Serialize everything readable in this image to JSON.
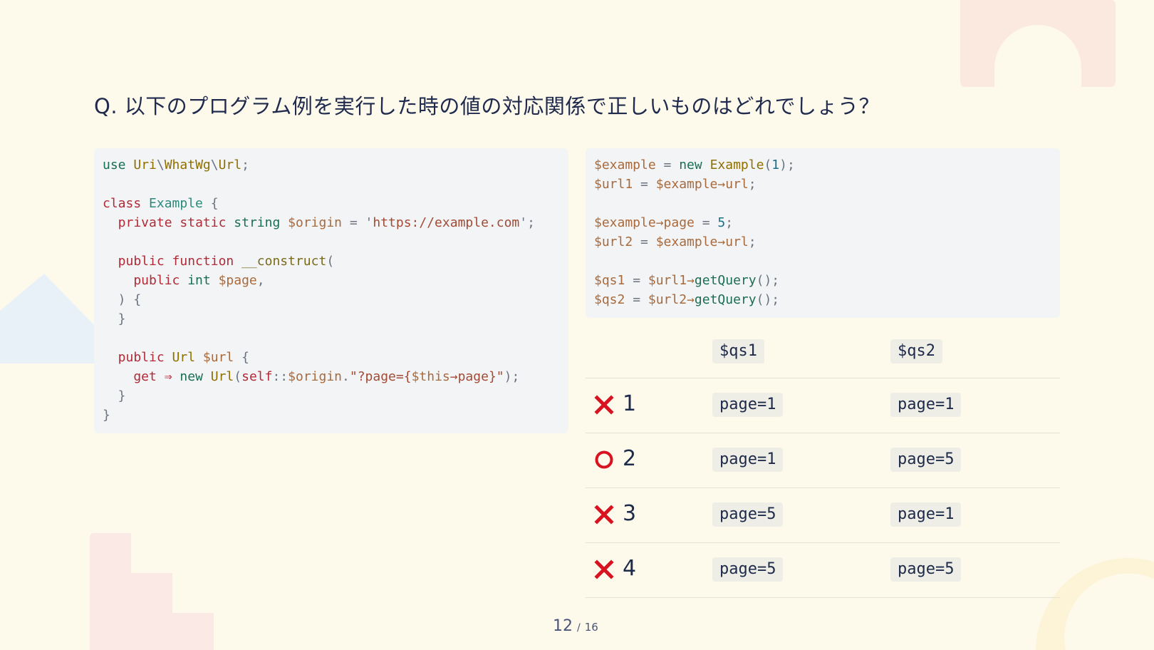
{
  "question": "Q. 以下のプログラム例を実行した時の値の対応関係で正しいものはどれでしょう？",
  "code_left": {
    "lines": [
      [
        [
          "use",
          "kw2"
        ],
        [
          " ",
          "p"
        ],
        [
          "Uri",
          "ns"
        ],
        [
          "\\",
          "p"
        ],
        [
          "WhatWg",
          "ns"
        ],
        [
          "\\",
          "p"
        ],
        [
          "Url",
          "ns"
        ],
        [
          ";",
          "p"
        ]
      ],
      [],
      [
        [
          "class",
          "kw"
        ],
        [
          " ",
          "p"
        ],
        [
          "Example",
          "cls"
        ],
        [
          " {",
          "p"
        ]
      ],
      [
        [
          "  private",
          "kw"
        ],
        [
          " ",
          "p"
        ],
        [
          "static",
          "kw"
        ],
        [
          " ",
          "p"
        ],
        [
          "string",
          "kw2"
        ],
        [
          " ",
          "p"
        ],
        [
          "$origin",
          "var"
        ],
        [
          " = ",
          "p"
        ],
        [
          "'",
          "p"
        ],
        [
          "https://example.com",
          "str"
        ],
        [
          "';",
          "p"
        ]
      ],
      [],
      [
        [
          "  public",
          "kw"
        ],
        [
          " ",
          "p"
        ],
        [
          "function",
          "kw"
        ],
        [
          " ",
          "p"
        ],
        [
          "__construct",
          "fn"
        ],
        [
          "(",
          "p"
        ]
      ],
      [
        [
          "    public",
          "kw"
        ],
        [
          " ",
          "p"
        ],
        [
          "int",
          "kw2"
        ],
        [
          " ",
          "p"
        ],
        [
          "$page",
          "var"
        ],
        [
          ",",
          "p"
        ]
      ],
      [
        [
          "  ) {",
          "p"
        ]
      ],
      [
        [
          "  }",
          "p"
        ]
      ],
      [],
      [
        [
          "  public",
          "kw"
        ],
        [
          " ",
          "p"
        ],
        [
          "Url",
          "ns"
        ],
        [
          " ",
          "p"
        ],
        [
          "$url",
          "var"
        ],
        [
          " {",
          "p"
        ]
      ],
      [
        [
          "    get",
          "kw"
        ],
        [
          " ",
          "p"
        ],
        [
          "⇒",
          "kw"
        ],
        [
          " ",
          "p"
        ],
        [
          "new",
          "kw2"
        ],
        [
          " ",
          "p"
        ],
        [
          "Url",
          "ns"
        ],
        [
          "(",
          "p"
        ],
        [
          "self",
          "kw"
        ],
        [
          "::",
          "p"
        ],
        [
          "$origin",
          "var"
        ],
        [
          ".",
          "p"
        ],
        [
          "\"?page={",
          "str"
        ],
        [
          "$this",
          "var"
        ],
        [
          "→",
          "str"
        ],
        [
          "page",
          "str"
        ],
        [
          "}\"",
          "str"
        ],
        [
          ");",
          "p"
        ]
      ],
      [
        [
          "  }",
          "p"
        ]
      ],
      [
        [
          "}",
          "p"
        ]
      ]
    ]
  },
  "code_right": {
    "lines": [
      [
        [
          "$example",
          "var"
        ],
        [
          " = ",
          "p"
        ],
        [
          "new",
          "kw2"
        ],
        [
          " ",
          "p"
        ],
        [
          "Example",
          "ns"
        ],
        [
          "(",
          "p"
        ],
        [
          "1",
          "num"
        ],
        [
          ");",
          "p"
        ]
      ],
      [
        [
          "$url1",
          "var"
        ],
        [
          " = ",
          "p"
        ],
        [
          "$example",
          "var"
        ],
        [
          "→",
          "var"
        ],
        [
          "url",
          "var"
        ],
        [
          ";",
          "p"
        ]
      ],
      [],
      [
        [
          "$example",
          "var"
        ],
        [
          "→",
          "var"
        ],
        [
          "page",
          "var"
        ],
        [
          " = ",
          "p"
        ],
        [
          "5",
          "num"
        ],
        [
          ";",
          "p"
        ]
      ],
      [
        [
          "$url2",
          "var"
        ],
        [
          " = ",
          "p"
        ],
        [
          "$example",
          "var"
        ],
        [
          "→",
          "var"
        ],
        [
          "url",
          "var"
        ],
        [
          ";",
          "p"
        ]
      ],
      [],
      [
        [
          "$qs1",
          "var"
        ],
        [
          " = ",
          "p"
        ],
        [
          "$url1",
          "var"
        ],
        [
          "→",
          "var"
        ],
        [
          "getQuery",
          "kw2"
        ],
        [
          "();",
          "p"
        ]
      ],
      [
        [
          "$qs2",
          "var"
        ],
        [
          " = ",
          "p"
        ],
        [
          "$url2",
          "var"
        ],
        [
          "→",
          "var"
        ],
        [
          "getQuery",
          "kw2"
        ],
        [
          "();",
          "p"
        ]
      ]
    ]
  },
  "answers": {
    "headers": [
      "$qs1",
      "$qs2"
    ],
    "rows": [
      {
        "mark": "cross-icon",
        "number": "1",
        "qs1": "page=1",
        "qs2": "page=1"
      },
      {
        "mark": "circle-icon",
        "number": "2",
        "qs1": "page=1",
        "qs2": "page=5"
      },
      {
        "mark": "cross-icon",
        "number": "3",
        "qs1": "page=5",
        "qs2": "page=1"
      },
      {
        "mark": "cross-icon",
        "number": "4",
        "qs1": "page=5",
        "qs2": "page=5"
      }
    ]
  },
  "pager": {
    "current": "12",
    "separator": "/",
    "total": "16"
  },
  "colors": {
    "background": "#fdfaec",
    "mark_red": "#d9121f"
  }
}
